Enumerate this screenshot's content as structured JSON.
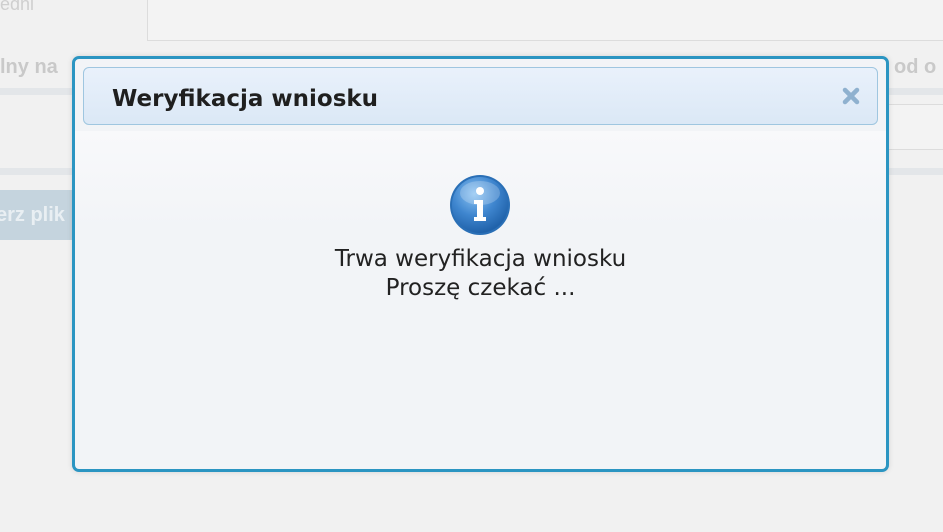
{
  "background": {
    "top_text": "edni",
    "label_left": "lny na",
    "label_right": "od o",
    "button_label": "erz plik"
  },
  "dialog": {
    "title": "Weryfikacja wniosku",
    "close_icon": "close-icon",
    "info_icon": "info-icon",
    "message_line1": "Trwa weryfikacja wniosku",
    "message_line2": "Proszę czekać ..."
  },
  "colors": {
    "dialog_border": "#2b95c2",
    "title_bar": "#dbe8f6",
    "info_icon": "#3a7fc4",
    "close_icon": "#8fb1cf"
  }
}
